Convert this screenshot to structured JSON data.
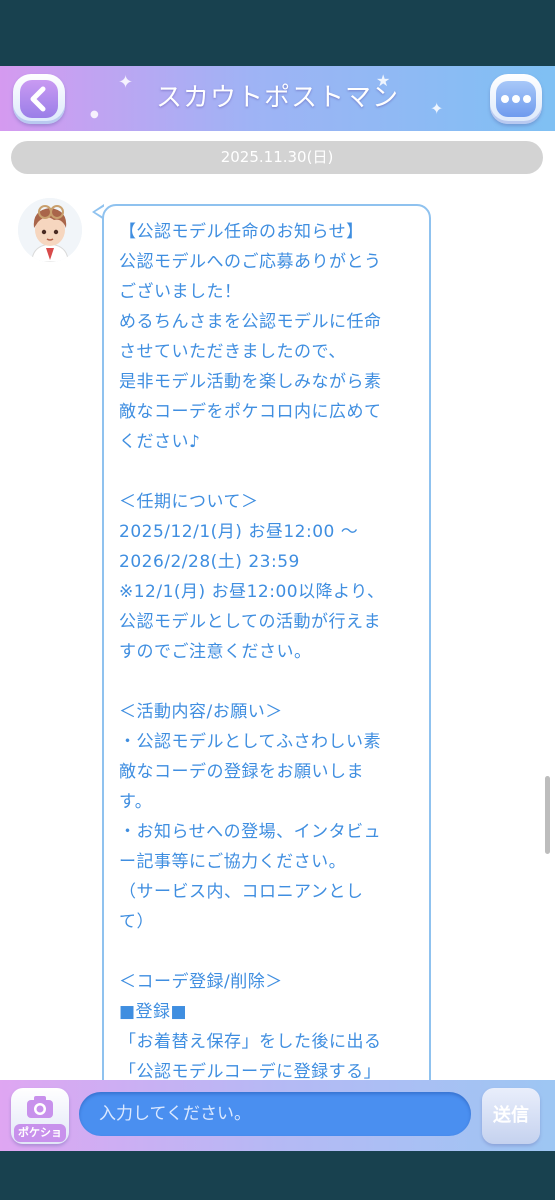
{
  "header": {
    "title": "スカウトポストマン",
    "back_icon": "chevron-left-icon",
    "menu_icon": "more-dots-icon"
  },
  "chat": {
    "date": "2025.11.30(日)",
    "message_lines": [
      "【公認モデル任命のお知らせ】",
      "公認モデルへのご応募ありがとう",
      "ございました！",
      "めるちんさまを公認モデルに任命",
      "させていただきましたので、",
      "是非モデル活動を楽しみながら素",
      "敵なコーデをポケコロ内に広めて",
      "ください♪",
      "",
      "＜任期について＞",
      "2025/12/1(月) お昼12:00 〜",
      "2026/2/28(土) 23:59",
      "※12/1(月) お昼12:00以降より、",
      "公認モデルとしての活動が行えま",
      "すのでご注意ください。",
      "",
      "＜活動内容/お願い＞",
      "・公認モデルとしてふさわしい素",
      "敵なコーデの登録をお願いしま",
      "す。",
      "・お知らせへの登場、インタビュ",
      "ー記事等にご協力ください。",
      "（サービス内、コロニアンとし",
      "て）",
      "",
      " ＜コーデ登録/削除＞",
      "■登録■",
      "「お着替え保存」をした後に出る",
      "「公認モデルコーデに登録する」"
    ]
  },
  "bottom": {
    "camera_label": "ポケショ",
    "input_placeholder": "入力してください。",
    "send_label": "送信"
  },
  "colors": {
    "message_text": "#3f8ee0",
    "bubble_border": "#8fc2ef",
    "input_bg": "#4a8ff0",
    "outer_bg": "#18414f"
  }
}
